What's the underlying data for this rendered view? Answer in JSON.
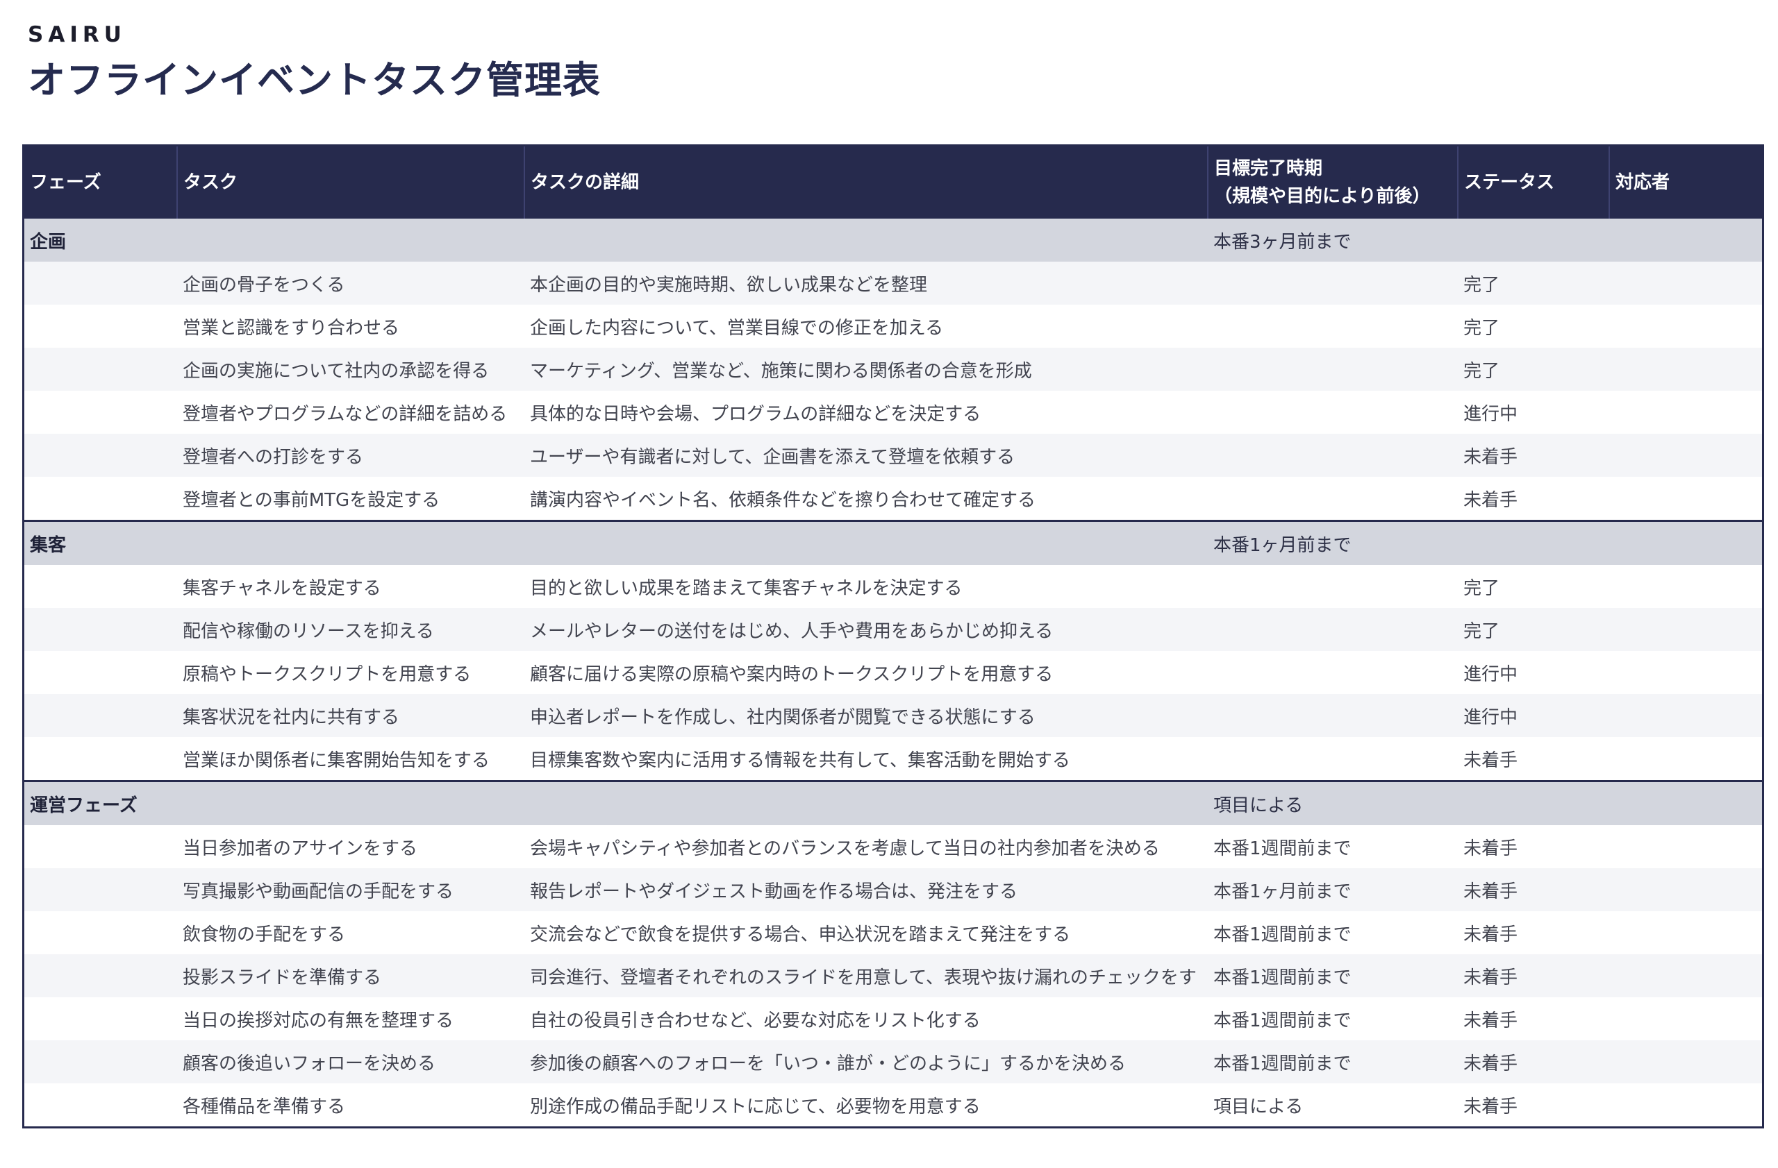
{
  "brand": "SAIRU",
  "title": "オフラインイベントタスク管理表",
  "columns": {
    "phase": "フェーズ",
    "task": "タスク",
    "detail": "タスクの詳細",
    "deadline_line1": "目標完了時期",
    "deadline_line2": "（規模や目的により前後）",
    "status": "ステータス",
    "owner": "対応者"
  },
  "sections": [
    {
      "phase": "企画",
      "deadline": "本番3ヶ月前まで",
      "tasks": [
        {
          "task": "企画の骨子をつくる",
          "detail": "本企画の目的や実施時期、欲しい成果などを整理",
          "deadline": "",
          "status": "完了",
          "owner": ""
        },
        {
          "task": "営業と認識をすり合わせる",
          "detail": "企画した内容について、営業目線での修正を加える",
          "deadline": "",
          "status": "完了",
          "owner": ""
        },
        {
          "task": "企画の実施について社内の承認を得る",
          "detail": "マーケティング、営業など、施策に関わる関係者の合意を形成",
          "deadline": "",
          "status": "完了",
          "owner": ""
        },
        {
          "task": "登壇者やプログラムなどの詳細を詰める",
          "detail": "具体的な日時や会場、プログラムの詳細などを決定する",
          "deadline": "",
          "status": "進行中",
          "owner": ""
        },
        {
          "task": "登壇者への打診をする",
          "detail": "ユーザーや有識者に対して、企画書を添えて登壇を依頼する",
          "deadline": "",
          "status": "未着手",
          "owner": ""
        },
        {
          "task": "登壇者との事前MTGを設定する",
          "detail": "講演内容やイベント名、依頼条件などを擦り合わせて確定する",
          "deadline": "",
          "status": "未着手",
          "owner": ""
        }
      ]
    },
    {
      "phase": "集客",
      "deadline": "本番1ヶ月前まで",
      "tasks": [
        {
          "task": "集客チャネルを設定する",
          "detail": "目的と欲しい成果を踏まえて集客チャネルを決定する",
          "deadline": "",
          "status": "完了",
          "owner": ""
        },
        {
          "task": "配信や稼働のリソースを抑える",
          "detail": "メールやレターの送付をはじめ、人手や費用をあらかじめ抑える",
          "deadline": "",
          "status": "完了",
          "owner": ""
        },
        {
          "task": "原稿やトークスクリプトを用意する",
          "detail": "顧客に届ける実際の原稿や案内時のトークスクリプトを用意する",
          "deadline": "",
          "status": "進行中",
          "owner": ""
        },
        {
          "task": "集客状況を社内に共有する",
          "detail": "申込者レポートを作成し、社内関係者が閲覧できる状態にする",
          "deadline": "",
          "status": "進行中",
          "owner": ""
        },
        {
          "task": "営業ほか関係者に集客開始告知をする",
          "detail": "目標集客数や案内に活用する情報を共有して、集客活動を開始する",
          "deadline": "",
          "status": "未着手",
          "owner": ""
        }
      ]
    },
    {
      "phase": "運営フェーズ",
      "deadline": "項目による",
      "tasks": [
        {
          "task": "当日参加者のアサインをする",
          "detail": "会場キャパシティや参加者とのバランスを考慮して当日の社内参加者を決める",
          "deadline": "本番1週間前まで",
          "status": "未着手",
          "owner": ""
        },
        {
          "task": "写真撮影や動画配信の手配をする",
          "detail": "報告レポートやダイジェスト動画を作る場合は、発注をする",
          "deadline": "本番1ヶ月前まで",
          "status": "未着手",
          "owner": ""
        },
        {
          "task": "飲食物の手配をする",
          "detail": "交流会などで飲食を提供する場合、申込状況を踏まえて発注をする",
          "deadline": "本番1週間前まで",
          "status": "未着手",
          "owner": ""
        },
        {
          "task": "投影スライドを準備する",
          "detail": "司会進行、登壇者それぞれのスライドを用意して、表現や抜け漏れのチェックをす",
          "deadline": "本番1週間前まで",
          "status": "未着手",
          "owner": ""
        },
        {
          "task": "当日の挨拶対応の有無を整理する",
          "detail": "自社の役員引き合わせなど、必要な対応をリスト化する",
          "deadline": "本番1週間前まで",
          "status": "未着手",
          "owner": ""
        },
        {
          "task": "顧客の後追いフォローを決める",
          "detail": "参加後の顧客へのフォローを「いつ・誰が・どのように」するかを決める",
          "deadline": "本番1週間前まで",
          "status": "未着手",
          "owner": ""
        },
        {
          "task": "各種備品を準備する",
          "detail": "別途作成の備品手配リストに応じて、必要物を用意する",
          "deadline": "項目による",
          "status": "未着手",
          "owner": ""
        }
      ]
    }
  ]
}
